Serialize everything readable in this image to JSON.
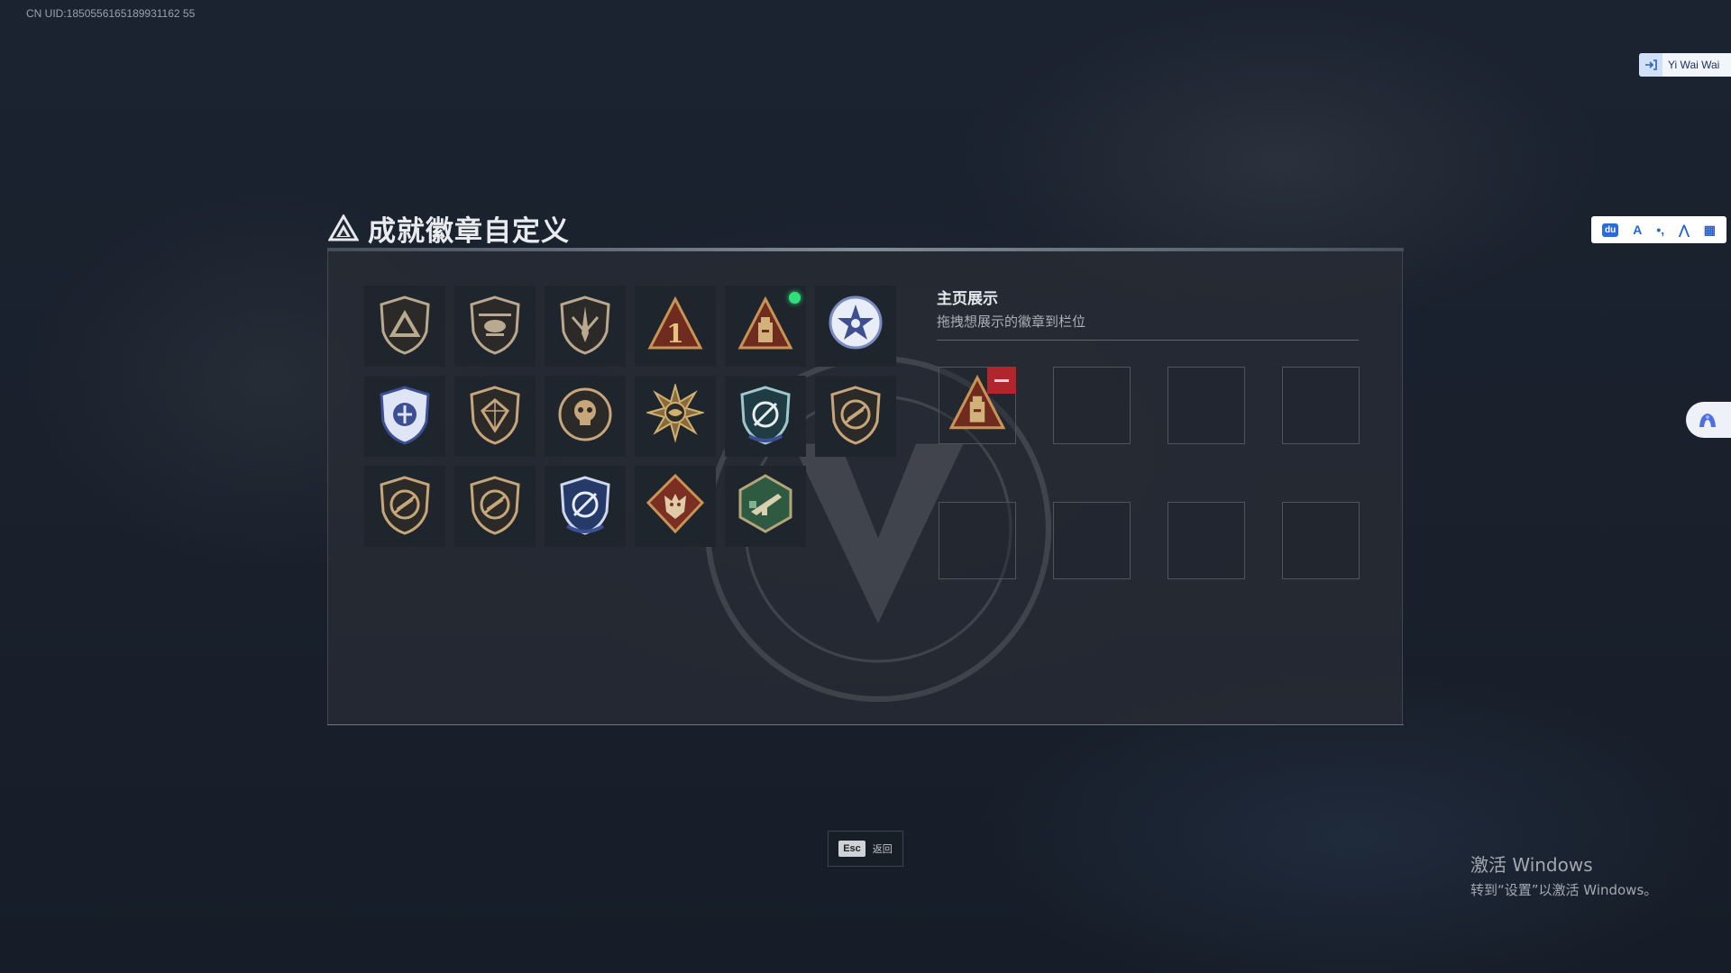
{
  "overlay": {
    "uid_text": "CN UID:1850556165189931162 55",
    "corner_tag": "Yi Wai Wai",
    "ime_bar": [
      "du",
      "A",
      "•,",
      "⋀",
      "▦"
    ]
  },
  "page": {
    "title": "成就徽章自定义",
    "badges": [
      {
        "icon": "triangle-emblem-badge-icon",
        "color": "#b9a98f"
      },
      {
        "icon": "helicopter-badge-icon",
        "color": "#b9a98f"
      },
      {
        "icon": "dagger-shield-badge-icon",
        "color": "#b9a98f"
      },
      {
        "icon": "number-one-triangle-badge-icon",
        "color": "#b8733d"
      },
      {
        "icon": "bunker-triangle-badge-icon",
        "color": "#b8733d",
        "is_new": true
      },
      {
        "icon": "star-wreath-badge-icon",
        "color": "#aab4d6"
      },
      {
        "icon": "blue-shield-badge-icon",
        "color": "#7f92c9"
      },
      {
        "icon": "gem-shield-badge-icon",
        "color": "#c7a77a"
      },
      {
        "icon": "skull-crest-badge-icon",
        "color": "#c7a77a"
      },
      {
        "icon": "spiked-sun-badge-icon",
        "color": "#d0b070"
      },
      {
        "icon": "teal-target-badge-icon",
        "color": "#5f9aa3"
      },
      {
        "icon": "no-rifle-badge-icon",
        "color": "#c7a77a"
      },
      {
        "icon": "no-rifle-badge-icon",
        "color": "#c7a77a"
      },
      {
        "icon": "no-rifle-badge-icon",
        "color": "#c7a77a"
      },
      {
        "icon": "blue-target-badge-icon",
        "color": "#7f92c9"
      },
      {
        "icon": "wolf-diamond-badge-icon",
        "color": "#b8733d"
      },
      {
        "icon": "green-rifle-hex-badge-icon",
        "color": "#6f9a78"
      }
    ],
    "showcase": {
      "title": "主页展示",
      "subtitle": "拖拽想展示的徽章到栏位",
      "slots": [
        {
          "filled": true,
          "icon": "bunker-triangle-badge-icon"
        },
        {
          "filled": false
        },
        {
          "filled": false
        },
        {
          "filled": false
        },
        {
          "filled": false
        },
        {
          "filled": false
        },
        {
          "filled": false
        },
        {
          "filled": false
        }
      ]
    },
    "esc": {
      "key": "Esc",
      "label": "返回"
    }
  },
  "system": {
    "activate_title": "激活 Windows",
    "activate_sub": "转到“设置”以激活 Windows。"
  }
}
